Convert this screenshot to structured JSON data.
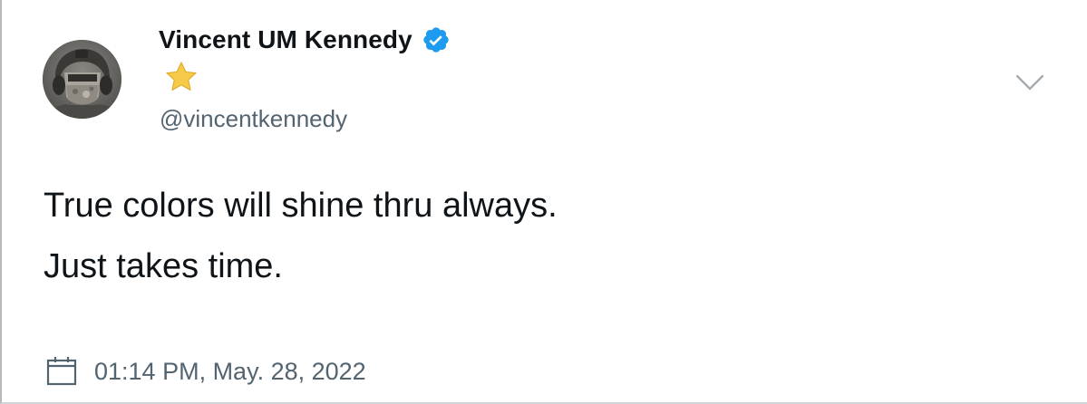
{
  "tweet": {
    "author": {
      "display_name": "Vincent UM Kennedy",
      "handle": "@vincentkennedy",
      "verified": true,
      "name_emoji": "star-emoji",
      "avatar": "avatar-photo"
    },
    "text_lines": [
      "True colors will shine thru always.",
      "Just takes time."
    ],
    "timestamp": "01:14 PM, May. 28, 2022",
    "icons": {
      "verified": "verified-badge-icon",
      "more": "chevron-down-icon",
      "date": "calendar-icon"
    }
  },
  "colors": {
    "text_primary": "#0f1419",
    "text_secondary": "#536471",
    "verified_blue": "#1d9bf0",
    "star_yellow": "#f7c948"
  }
}
